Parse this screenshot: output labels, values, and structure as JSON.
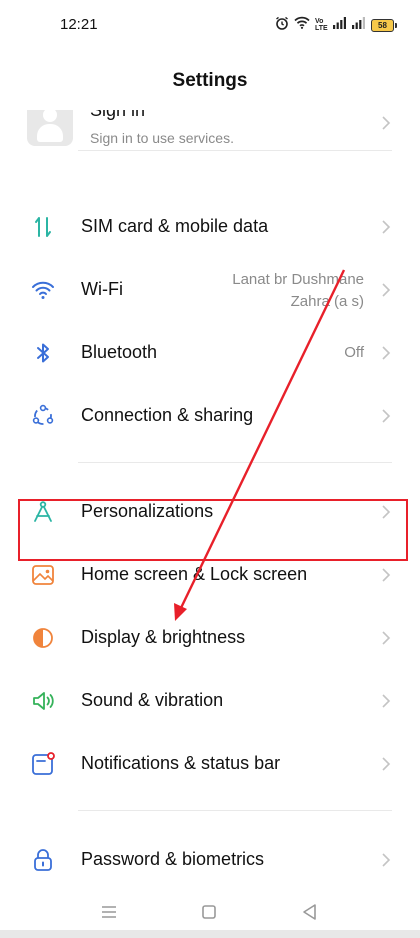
{
  "status_bar": {
    "time": "12:21",
    "volte_top": "Vo",
    "volte_bottom": "LTE",
    "battery": "58"
  },
  "header": {
    "title": "Settings"
  },
  "account": {
    "title": "Sign in",
    "subtitle": "Sign in to use services."
  },
  "items": [
    {
      "label": "SIM card & mobile data",
      "value": "",
      "icon": "sim-data-icon"
    },
    {
      "label": "Wi-Fi",
      "value_line1": "Lanat br Dushmane",
      "value_line2": "Zahra (a s)",
      "icon": "wifi-icon"
    },
    {
      "label": "Bluetooth",
      "value": "Off",
      "icon": "bluetooth-icon"
    },
    {
      "label": "Connection & sharing",
      "value": "",
      "icon": "connection-icon"
    },
    {
      "label": "Personalizations",
      "value": "",
      "icon": "personalization-icon"
    },
    {
      "label": "Home screen & Lock screen",
      "value": "",
      "icon": "home-screen-icon"
    },
    {
      "label": "Display & brightness",
      "value": "",
      "icon": "display-icon"
    },
    {
      "label": "Sound & vibration",
      "value": "",
      "icon": "sound-icon"
    },
    {
      "label": "Notifications & status bar",
      "value": "",
      "icon": "notification-icon"
    },
    {
      "label": "Password & biometrics",
      "value": "",
      "icon": "lock-icon"
    }
  ],
  "colors": {
    "annotation_red": "#e8202a",
    "teal_icon": "#2bb5a4",
    "blue_icon": "#3a6fd8",
    "orange_icon": "#f0843c",
    "green_icon": "#35b25a"
  }
}
